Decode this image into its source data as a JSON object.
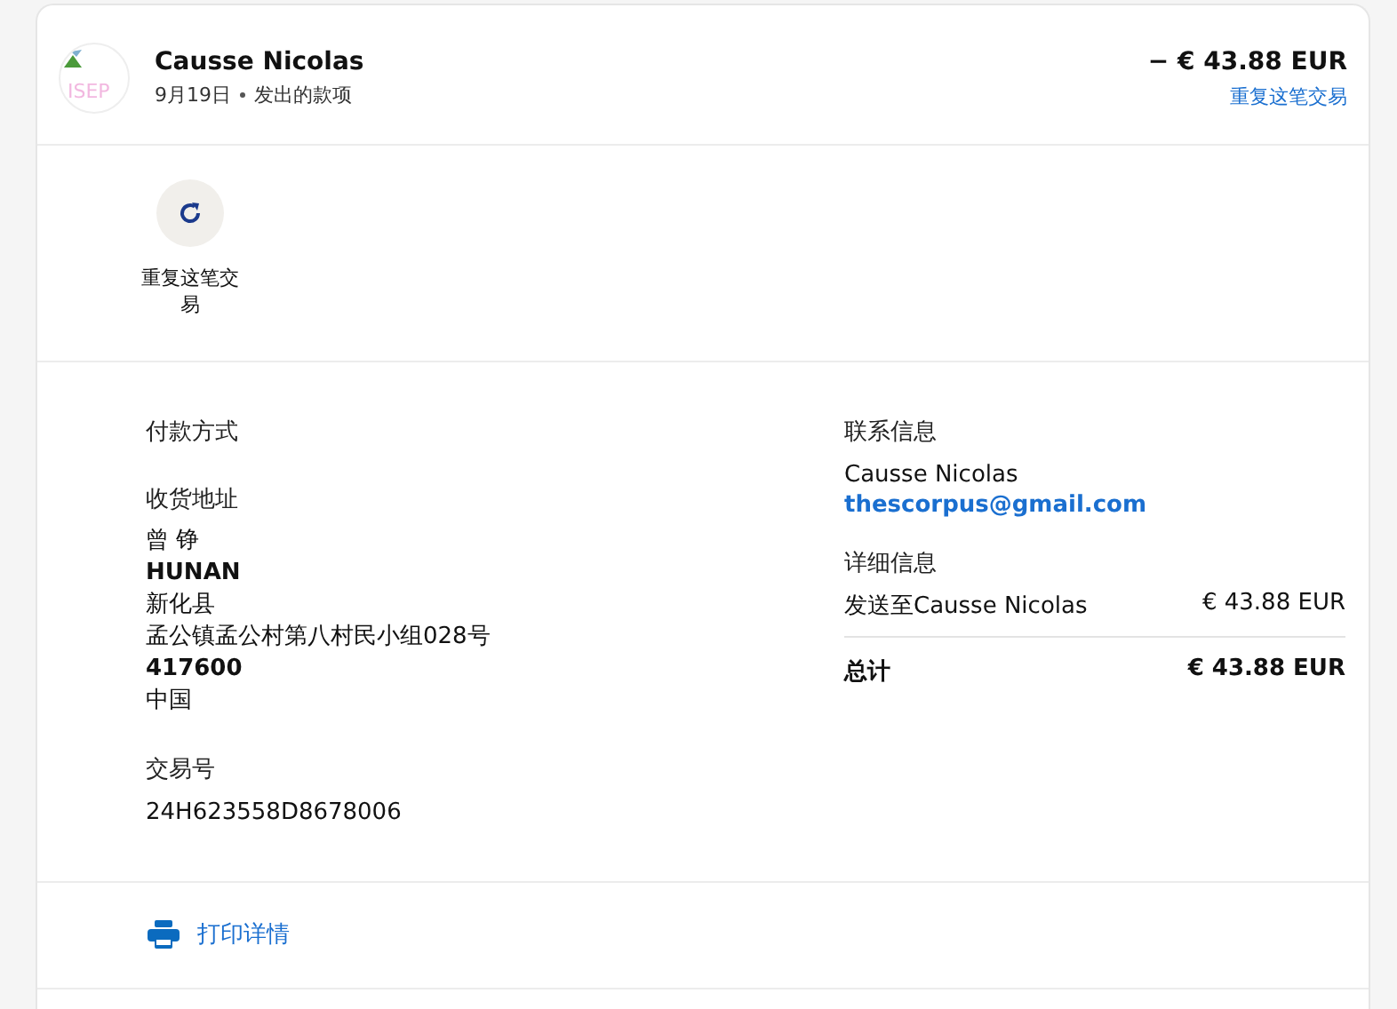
{
  "header": {
    "avatar_text": "ISEP",
    "name": "Causse Nicolas",
    "date": "9月19日",
    "description": "发出的款项",
    "amount": "− € 43.88 EUR",
    "repeat_link": "重复这笔交易"
  },
  "actions": [
    {
      "label": "重复这笔交易"
    }
  ],
  "left": {
    "payment_method_label": "付款方式",
    "shipping_label": "收货地址",
    "address_lines": [
      {
        "text": "曾 铮",
        "bold": false
      },
      {
        "text": "HUNAN",
        "bold": true
      },
      {
        "text": "新化县",
        "bold": false
      },
      {
        "text": "孟公镇孟公村第八村民小组028号",
        "bold": false
      },
      {
        "text": "417600",
        "bold": true
      },
      {
        "text": "中国",
        "bold": false
      }
    ],
    "transaction_label": "交易号",
    "transaction_id": "24H623558D8678006"
  },
  "right": {
    "contact_label": "联系信息",
    "contact_name": "Causse Nicolas",
    "contact_email": "thescorpus@gmail.com",
    "details_label": "详细信息",
    "lines": [
      {
        "label": "发送至Causse Nicolas",
        "value": "€ 43.88 EUR",
        "kind": "item"
      },
      {
        "label": "总计",
        "value": "€ 43.88 EUR",
        "kind": "total"
      }
    ]
  },
  "print": {
    "label": "打印详情"
  }
}
